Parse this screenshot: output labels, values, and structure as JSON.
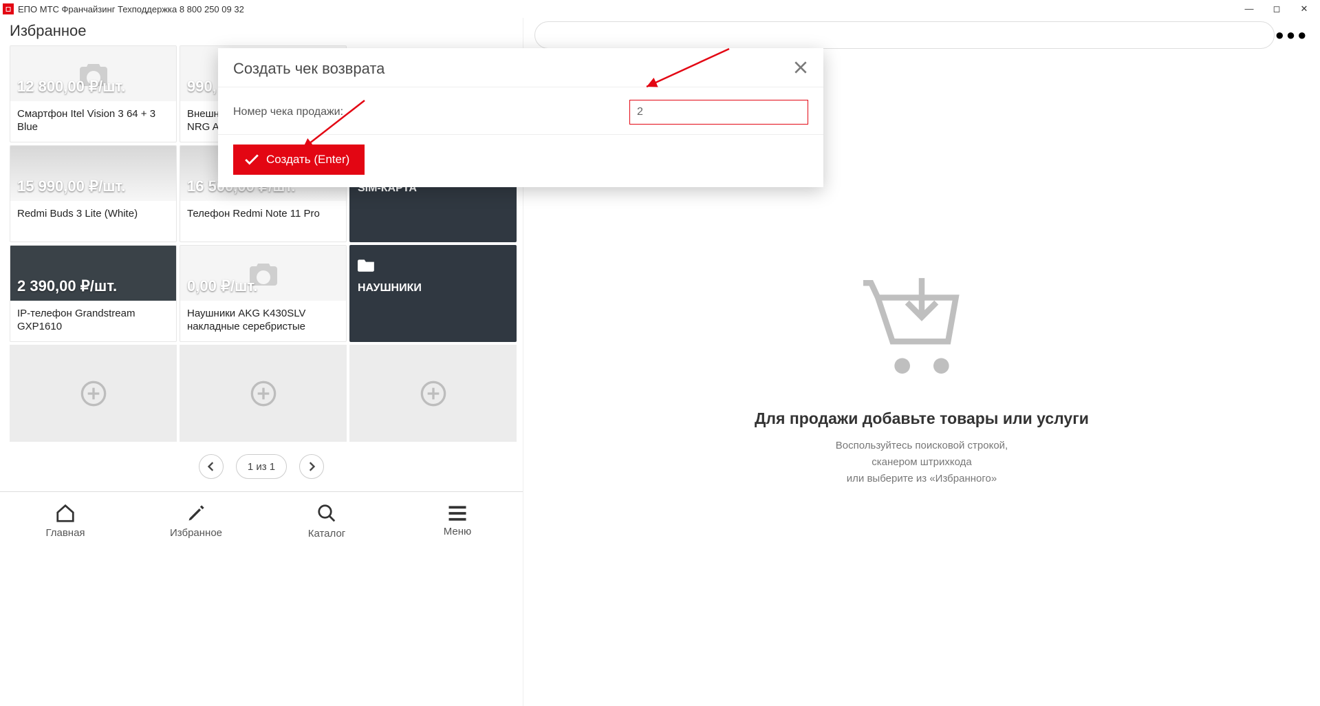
{
  "window": {
    "title": "ЕПО МТС Франчайзинг Техподдержка 8 800 250 09 32"
  },
  "favorites": {
    "header": "Избранное",
    "items": [
      {
        "price": "12 800,00 ₽/шт.",
        "name": "Смартфон Itel Vision 3 64 + 3 Blue"
      },
      {
        "price": "990,",
        "name": "Внешн\nNRG A"
      },
      {
        "price": "15 990,00 ₽/шт.",
        "name": "Redmi Buds 3 Lite (White)"
      },
      {
        "price": "16 500,00 ₽/шт.",
        "name": "Телефон Redmi Note 11 Pro"
      },
      {
        "folder": "SIM-КАРТА"
      },
      {
        "price": "2 390,00 ₽/шт.",
        "name": "IP-телефон Grandstream GXP1610"
      },
      {
        "price": "0,00 ₽/шт.",
        "name": "Наушники AKG K430SLV накладные серебристые"
      },
      {
        "folder": "НАУШНИКИ"
      }
    ],
    "pager": "1 из 1"
  },
  "nav": {
    "home": "Главная",
    "favorites": "Избранное",
    "catalog": "Каталог",
    "menu": "Меню"
  },
  "cart": {
    "title": "Для продажи добавьте товары или услуги",
    "line1": "Воспользуйтесь поисковой строкой,",
    "line2": "сканером штрихкода",
    "line3": "или выберите из «Избранного»"
  },
  "modal": {
    "title": "Создать чек возврата",
    "label": "Номер чека продажи:",
    "value": "2",
    "create": "Создать (Enter)"
  }
}
